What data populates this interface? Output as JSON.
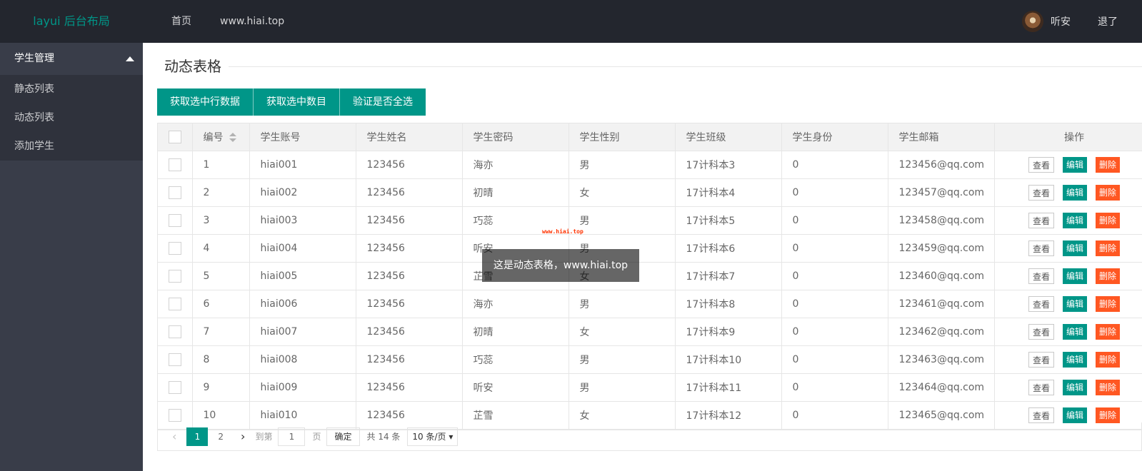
{
  "header": {
    "logo": "layui 后台布局",
    "nav": [
      "首页",
      "www.hiai.top"
    ],
    "user_name": "听安",
    "logout": "退了"
  },
  "sidebar": {
    "group": "学生管理",
    "items": [
      "静态列表",
      "动态列表",
      "添加学生"
    ]
  },
  "main": {
    "title": "动态表格",
    "buttons": [
      "获取选中行数据",
      "获取选中数目",
      "验证是否全选"
    ]
  },
  "table": {
    "columns": [
      "编号",
      "学生账号",
      "学生姓名",
      "学生密码",
      "学生性别",
      "学生班级",
      "学生身份",
      "学生邮箱",
      "操作"
    ],
    "rows": [
      [
        "1",
        "hiai001",
        "123456",
        "海亦",
        "男",
        "17计科本3",
        "0",
        "123456@qq.com"
      ],
      [
        "2",
        "hiai002",
        "123456",
        "初晴",
        "女",
        "17计科本4",
        "0",
        "123457@qq.com"
      ],
      [
        "3",
        "hiai003",
        "123456",
        "巧蕊",
        "男",
        "17计科本5",
        "0",
        "123458@qq.com"
      ],
      [
        "4",
        "hiai004",
        "123456",
        "听安",
        "男",
        "17计科本6",
        "0",
        "123459@qq.com"
      ],
      [
        "5",
        "hiai005",
        "123456",
        "芷雪",
        "女",
        "17计科本7",
        "0",
        "123460@qq.com"
      ],
      [
        "6",
        "hiai006",
        "123456",
        "海亦",
        "男",
        "17计科本8",
        "0",
        "123461@qq.com"
      ],
      [
        "7",
        "hiai007",
        "123456",
        "初晴",
        "女",
        "17计科本9",
        "0",
        "123462@qq.com"
      ],
      [
        "8",
        "hiai008",
        "123456",
        "巧蕊",
        "男",
        "17计科本10",
        "0",
        "123463@qq.com"
      ],
      [
        "9",
        "hiai009",
        "123456",
        "听安",
        "男",
        "17计科本11",
        "0",
        "123464@qq.com"
      ],
      [
        "10",
        "hiai010",
        "123456",
        "芷雪",
        "女",
        "17计科本12",
        "0",
        "123465@qq.com"
      ]
    ],
    "actions": {
      "view": "查看",
      "edit": "编辑",
      "delete": "删除"
    }
  },
  "pager": {
    "pages": [
      "1",
      "2"
    ],
    "current": "1",
    "goto_label": "到第",
    "goto_value": "1",
    "page_unit": "页",
    "confirm": "确定",
    "total": "共 14 条",
    "limit": "10 条/页"
  },
  "toast": "这是动态表格，www.hiai.top",
  "watermark": "www.hiai.top",
  "colors": {
    "header_bg": "#23262e",
    "side_bg": "#393d49",
    "accent": "#009688",
    "danger": "#ff5722"
  }
}
